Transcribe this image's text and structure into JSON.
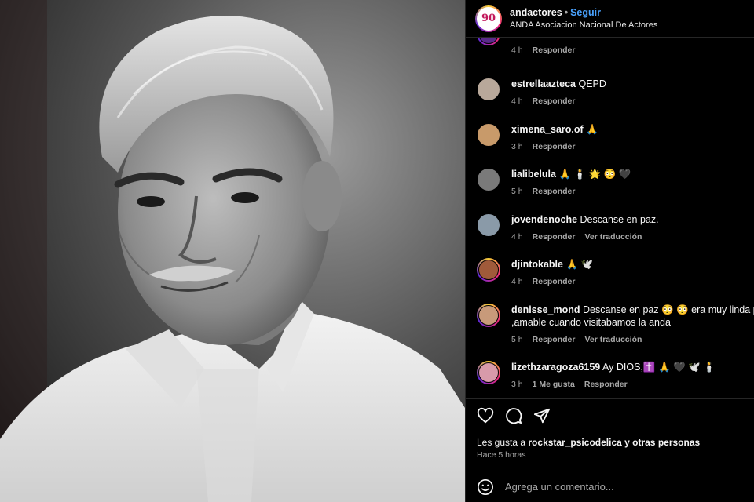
{
  "header": {
    "username": "andactores",
    "separator": "•",
    "follow_label": "Seguir",
    "subtitle": "ANDA Asociacion Nacional De Actores",
    "avatar_text": "90"
  },
  "comments": [
    {
      "user": "",
      "text": "",
      "time": "4 h",
      "reply": "Responder",
      "likes": "",
      "translate": "",
      "avatar_color": "#5a2a8a",
      "ring": true
    },
    {
      "user": "estrellaazteca",
      "text": "QEPD",
      "time": "4 h",
      "reply": "Responder",
      "likes": "",
      "translate": "",
      "avatar_color": "#b8a89a",
      "ring": false
    },
    {
      "user": "ximena_saro.of",
      "text": "🙏",
      "time": "3 h",
      "reply": "Responder",
      "likes": "",
      "translate": "",
      "avatar_color": "#c89a6a",
      "ring": false
    },
    {
      "user": "lialibelula",
      "text": "🙏 🕯️ 🌟 😳 🖤",
      "time": "5 h",
      "reply": "Responder",
      "likes": "",
      "translate": "",
      "avatar_color": "#7a7a7a",
      "ring": false
    },
    {
      "user": "jovendenoche",
      "text": "Descanse en paz.",
      "time": "4 h",
      "reply": "Responder",
      "likes": "",
      "translate": "Ver traducción",
      "avatar_color": "#8a9aa8",
      "ring": false
    },
    {
      "user": "djintokable",
      "text": "🙏 🕊️",
      "time": "4 h",
      "reply": "Responder",
      "likes": "",
      "translate": "",
      "avatar_color": "#a05a3a",
      "ring": true
    },
    {
      "user": "denisse_mond",
      "text": "Descanse en paz 😳 😳 era muy linda persona",
      "text2": ",amable cuando visitabamos la anda",
      "time": "5 h",
      "reply": "Responder",
      "likes": "",
      "translate": "Ver traducción",
      "avatar_color": "#c89a7a",
      "ring": true
    },
    {
      "user": "lizethzaragoza6159",
      "text": "Ay DIOS,✝️ 🙏 🖤 🕊️ 🕯️",
      "time": "3 h",
      "reply": "Responder",
      "likes": "1 Me gusta",
      "translate": "",
      "avatar_color": "#d89aaa",
      "ring": true
    }
  ],
  "actions": {
    "likes_prefix": "Les gusta a ",
    "likes_user": "rockstar_psicodelica",
    "likes_suffix": " y otras personas",
    "time_ago": "Hace 5 horas"
  },
  "add_comment": {
    "placeholder": "Agrega un comentario..."
  },
  "icons": [
    "heart-icon",
    "comment-icon",
    "share-icon",
    "emoji-icon"
  ]
}
